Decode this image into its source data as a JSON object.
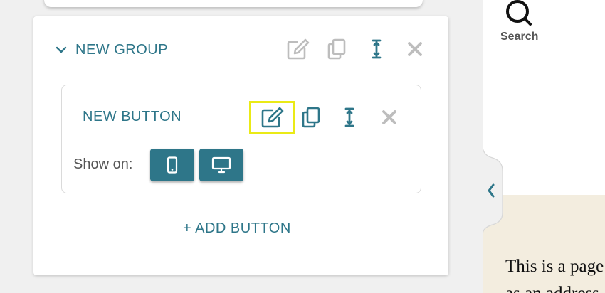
{
  "group": {
    "title": "NEW GROUP",
    "actions": [
      "edit-icon",
      "copy-icon",
      "resize-icon",
      "close-icon"
    ]
  },
  "button_item": {
    "title": "NEW BUTTON",
    "actions": [
      "edit-icon",
      "copy-icon",
      "resize-icon",
      "close-icon"
    ],
    "show_on_label": "Show on:",
    "devices": [
      "mobile-icon",
      "desktop-icon"
    ]
  },
  "add_button_label": "+ ADD BUTTON",
  "search": {
    "label": "Search"
  },
  "page_preview": {
    "line1": "This is a page",
    "line2": "as an address"
  },
  "colors": {
    "accent": "#2e7689",
    "muted_icon": "#bdbdbd",
    "highlight": "#eaea16",
    "preview_bg": "#f3eddf"
  }
}
